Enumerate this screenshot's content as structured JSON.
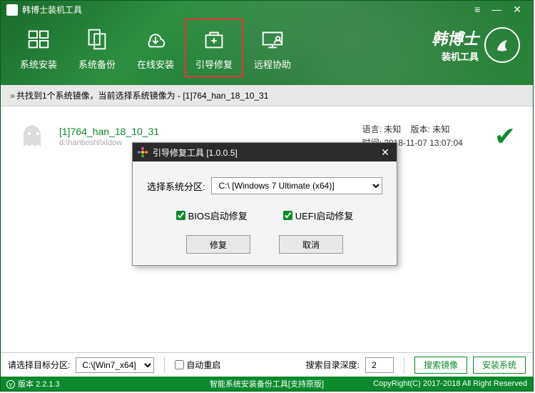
{
  "window": {
    "title": "韩博士装机工具"
  },
  "brand": {
    "main": "韩博士",
    "sub": "装机工具"
  },
  "toolbar": {
    "items": [
      {
        "label": "系统安装"
      },
      {
        "label": "系统备份"
      },
      {
        "label": "在线安装"
      },
      {
        "label": "引导修复"
      },
      {
        "label": "远程协助"
      }
    ]
  },
  "status": {
    "text": "共找到1个系统镜像，当前选择系统镜像为 - [1]764_han_18_10_31"
  },
  "image": {
    "name": "[1]764_han_18_10_31",
    "path": "d:\\hanboshi\\xldow",
    "lang_label": "语言:",
    "lang_value": "未知",
    "ver_label": "版本:",
    "ver_value": "未知",
    "time_label": "时间:",
    "time_value": "2018-11-07 13:07:04"
  },
  "dialog": {
    "title": "引导修复工具 [1.0.0.5]",
    "partition_label": "选择系统分区:",
    "partition_value": "C:\\ [Windows 7 Ultimate (x64)]",
    "bios_label": "BIOS启动修复",
    "uefi_label": "UEFI启动修复",
    "repair_btn": "修复",
    "cancel_btn": "取消"
  },
  "bottom": {
    "target_label": "请选择目标分区:",
    "target_value": "C:\\[Win7_x64]",
    "auto_restart": "自动重启",
    "search_depth_label": "搜索目录深度:",
    "search_depth_value": "2",
    "search_btn": "搜索镜像",
    "install_btn": "安装系统"
  },
  "footer": {
    "version_label": "版本",
    "version": "2.2.1.3",
    "center": "智能系统安装备份工具[支持原版]",
    "copyright": "CopyRight(C) 2017-2018 All Right Reserved"
  }
}
